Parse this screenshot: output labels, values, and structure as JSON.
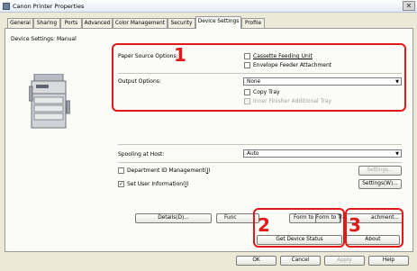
{
  "window": {
    "title": "Canon Printer Properties"
  },
  "tabs": [
    "General",
    "Sharing",
    "Ports",
    "Advanced",
    "Color Management",
    "Security",
    "Device Settings",
    "Profile"
  ],
  "page": {
    "heading": "Device Settings: Manual"
  },
  "paper_source": {
    "label": "Paper Source Options:",
    "cassette": "Cassette Feeding Unit",
    "envelope": "Envelope Feeder Attachment"
  },
  "output": {
    "label": "Output Options:",
    "value": "None",
    "copy_tray": "Copy Tray",
    "inner_finisher": "Inner Finisher Additional Tray"
  },
  "spooling": {
    "label": "Spooling at Host:",
    "value": "Auto"
  },
  "department": {
    "label": "Department ID Management(",
    "underline": "J",
    "tail": ")",
    "button": "Settings..."
  },
  "user_info": {
    "label": "Set User Information(",
    "underline": "I",
    "tail": ")",
    "checked": "✓",
    "button": "Settings(W)..."
  },
  "row_buttons": {
    "details": "Details(D)...",
    "func": "Func",
    "form_to_tray_a": "Form to Tr",
    "form_to_tray_b": "Form to Tray...",
    "attachment": "achment..."
  },
  "status_row": {
    "get_status": "Get Device Status",
    "about": "About"
  },
  "bottom": {
    "ok": "OK",
    "cancel": "Cancel",
    "apply": "Apply",
    "help": "Help"
  },
  "annotations": [
    "1",
    "2",
    "3"
  ],
  "colors": {
    "annotation": "#e11919"
  }
}
